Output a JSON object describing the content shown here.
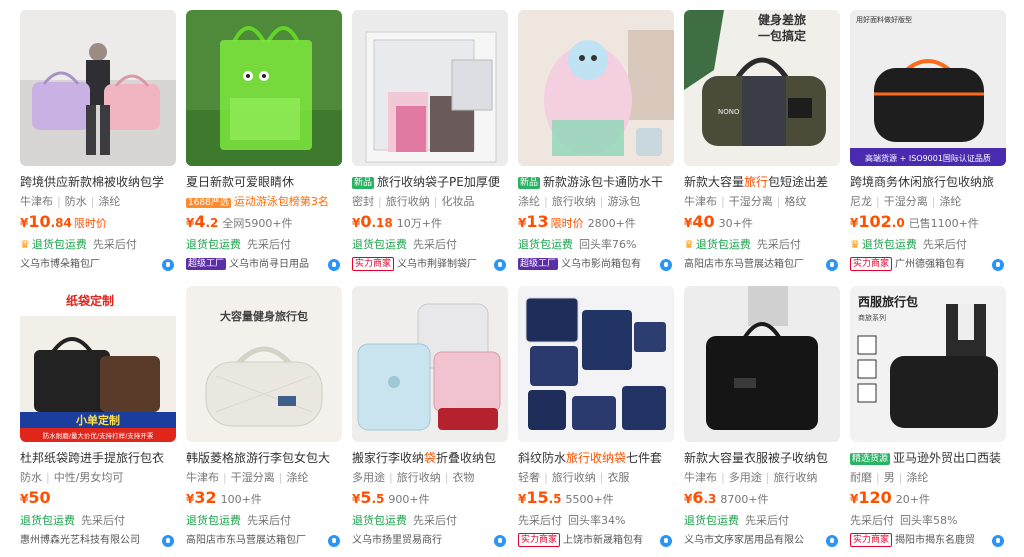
{
  "products": [
    {
      "prefix": "",
      "title_pre": "跨境供应新款棉被收纳包学",
      "title_hl": "",
      "title_post": "",
      "attrs": [
        "牛津布",
        "防水",
        "涤纶"
      ],
      "price_int": "10",
      "price_dec": ".84",
      "price_tag": "限时价",
      "sales": "",
      "services": [
        "退货包运费",
        "先采后付"
      ],
      "crown": true,
      "shop_badge": "",
      "shop": "义乌市博朵箱包厂"
    },
    {
      "prefix": "",
      "title_pre": "夏日新款可爱眼睛休",
      "title_hl": "",
      "title_post": "",
      "attrs": [
        "运动游泳包榜第3名"
      ],
      "attrs_tag": "1688严选",
      "price_int": "4",
      "price_dec": ".2",
      "price_tag": "",
      "sales": "全网5900+件",
      "services": [
        "退货包运费",
        "先采后付"
      ],
      "crown": false,
      "shop_badge": "超级工厂",
      "shop": "义乌市尚寻日用品"
    },
    {
      "prefix": "新品",
      "title_pre": "旅行收纳袋子PE加厚便",
      "title_hl": "",
      "title_post": "",
      "attrs": [
        "密封",
        "旅行收纳",
        "化妆品"
      ],
      "price_int": "0",
      "price_dec": ".18",
      "price_tag": "",
      "sales": "10万+件",
      "services": [
        "退货包运费",
        "先采后付"
      ],
      "crown": false,
      "shop_badge": "实力商家",
      "shop": "义乌市荆驿制袋厂"
    },
    {
      "prefix": "新品",
      "title_pre": "新款游泳包卡通防水干",
      "title_hl": "",
      "title_post": "",
      "attrs": [
        "涤纶",
        "旅行收纳",
        "游泳包"
      ],
      "price_int": "13",
      "price_dec": "",
      "price_tag": "限时价",
      "sales": "2800+件",
      "services": [
        "退货包运费",
        "回头率76%"
      ],
      "crown": false,
      "shop_badge": "超级工厂",
      "shop": "义乌市影尚箱包有"
    },
    {
      "prefix": "",
      "title_pre": "新款大容量",
      "title_hl": "旅行",
      "title_post": "包短途出差",
      "attrs": [
        "牛津布",
        "干湿分离",
        "格纹"
      ],
      "price_int": "40",
      "price_dec": "",
      "price_tag": "",
      "sales": "30+件",
      "services": [
        "退货包运费",
        "先采后付"
      ],
      "crown": true,
      "shop_badge": "",
      "shop": "高阳店市东马营展达箱包厂"
    },
    {
      "prefix": "",
      "title_pre": "跨境商务休闲旅行包收纳旅",
      "title_hl": "",
      "title_post": "",
      "attrs": [
        "尼龙",
        "干湿分离",
        "涤纶"
      ],
      "price_int": "102",
      "price_dec": ".0",
      "price_tag": "",
      "sales": "已售1100+件",
      "services": [
        "退货包运费",
        "先采后付"
      ],
      "crown": true,
      "shop_badge": "实力商家",
      "shop": "广州德强箱包有"
    },
    {
      "prefix": "",
      "title_pre": "杜邦纸袋跨进手提旅行包衣",
      "title_hl": "",
      "title_post": "",
      "attrs": [
        "防水",
        "中性/男女均可"
      ],
      "price_int": "50",
      "price_dec": "",
      "price_tag": "",
      "sales": "",
      "services": [
        "退货包运费",
        "先采后付"
      ],
      "crown": false,
      "shop_badge": "",
      "shop": "惠州博森光艺科技有限公司"
    },
    {
      "prefix": "",
      "title_pre": "韩版菱格旅游行李包女包大",
      "title_hl": "",
      "title_post": "",
      "attrs": [
        "牛津布",
        "干湿分离",
        "涤纶"
      ],
      "price_int": "32",
      "price_dec": "",
      "price_tag": "",
      "sales": "100+件",
      "services": [
        "退货包运费",
        "先采后付"
      ],
      "crown": false,
      "shop_badge": "",
      "shop": "高阳店市东马营展达箱包厂"
    },
    {
      "prefix": "",
      "title_pre": "搬家行李收纳",
      "title_hl": "袋",
      "title_post": "折叠收纳包",
      "attrs": [
        "多用途",
        "旅行收纳",
        "衣物"
      ],
      "price_int": "5",
      "price_dec": ".5",
      "price_tag": "",
      "sales": "900+件",
      "services": [
        "退货包运费",
        "先采后付"
      ],
      "crown": false,
      "shop_badge": "",
      "shop": "义乌市扬里贸易商行"
    },
    {
      "prefix": "",
      "title_pre": "斜纹防水",
      "title_hl": "旅行收纳袋",
      "title_post": "七件套",
      "attrs": [
        "轻奢",
        "旅行收纳",
        "衣服"
      ],
      "price_int": "15",
      "price_dec": ".5",
      "price_tag": "",
      "sales": "5500+件",
      "services": [
        "先采后付",
        "回头率34%"
      ],
      "crown": false,
      "shop_badge": "实力商家",
      "shop": "上饶市新晟箱包有"
    },
    {
      "prefix": "",
      "title_pre": "新款大容量衣服被子收纳包",
      "title_hl": "",
      "title_post": "",
      "attrs": [
        "牛津布",
        "多用途",
        "旅行收纳"
      ],
      "price_int": "6",
      "price_dec": ".3",
      "price_tag": "",
      "sales": "8700+件",
      "services": [
        "退货包运费",
        "先采后付"
      ],
      "crown": false,
      "shop_badge": "",
      "shop": "义乌市文序家居用品有限公"
    },
    {
      "prefix": "精选货源",
      "title_pre": "亚马逊外贸出口西装",
      "title_hl": "",
      "title_post": "",
      "attrs": [
        "耐磨",
        "男",
        "涤纶"
      ],
      "price_int": "120",
      "price_dec": "",
      "price_tag": "",
      "sales": "20+件",
      "services": [
        "先采后付",
        "回头率58%"
      ],
      "crown": false,
      "shop_badge": "实力商家",
      "shop": "揭阳市揭东名鹿贸"
    }
  ],
  "currency": "¥",
  "image_text": {
    "p5_line1": "健身差旅",
    "p5_line2": "一包搞定",
    "p6_top": "用好面料做好版型",
    "p6_bottom": "高端货源 + ISO9001国际认证品质",
    "p7_top": "纸袋定制",
    "p7_mid": "小单定制",
    "p7_bottom": "防水耐磨/量大价优/支持打样/支持开票",
    "p8_top": "大容量健身旅行包",
    "p12_top": "西服旅行包",
    "p12_sub": "商旅系列"
  }
}
